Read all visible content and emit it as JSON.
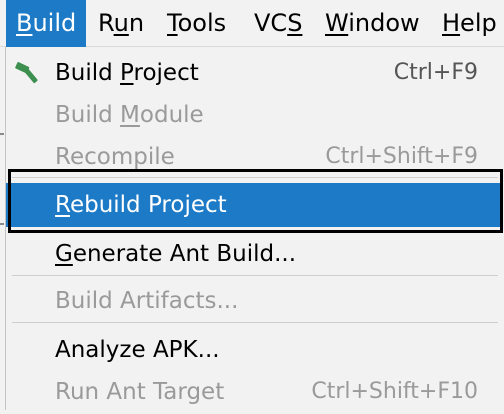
{
  "menubar": {
    "items": [
      {
        "label": "Build",
        "mnemonic_char": "B",
        "rest": "uild",
        "active": true
      },
      {
        "label": "Run",
        "pre": "R",
        "mnemonic_char": "u",
        "rest": "n"
      },
      {
        "label": "Tools",
        "mnemonic_char": "T",
        "rest": "ools"
      },
      {
        "label": "VCS",
        "pre": "VC",
        "mnemonic_char": "S",
        "rest": ""
      },
      {
        "label": "Window",
        "mnemonic_char": "W",
        "rest": "indow"
      },
      {
        "label": "Help",
        "pre": "",
        "mnemonic_char": "H",
        "rest": "elp"
      }
    ]
  },
  "build_menu": {
    "items": [
      {
        "pre": "Build ",
        "mnemonic_char": "P",
        "rest": "roject",
        "shortcut": "Ctrl+F9",
        "enabled": true,
        "icon": "hammer-icon"
      },
      {
        "pre": "Build ",
        "mnemonic_char": "M",
        "rest": "odule",
        "shortcut": "",
        "enabled": false
      },
      {
        "pre": "Recompile",
        "mnemonic_char": "",
        "rest": "",
        "shortcut": "Ctrl+Shift+F9",
        "enabled": false
      },
      {
        "pre": "",
        "mnemonic_char": "R",
        "rest": "ebuild Project",
        "shortcut": "",
        "enabled": true,
        "selected": true
      },
      {
        "pre": "",
        "mnemonic_char": "G",
        "rest": "enerate Ant Build...",
        "shortcut": "",
        "enabled": true
      },
      {
        "pre": "Build Artifacts...",
        "mnemonic_char": "",
        "rest": "",
        "shortcut": "",
        "enabled": false
      },
      {
        "pre": "Analyze APK...",
        "mnemonic_char": "",
        "rest": "",
        "shortcut": "",
        "enabled": true
      },
      {
        "pre": "Run Ant Target",
        "mnemonic_char": "",
        "rest": "",
        "shortcut": "Ctrl+Shift+F10",
        "enabled": false
      }
    ]
  },
  "colors": {
    "accent": "#1c7ac6",
    "menu_bg": "#f2f2f2",
    "disabled_text": "#9a9a9a",
    "hammer_green": "#3d8f4f"
  }
}
